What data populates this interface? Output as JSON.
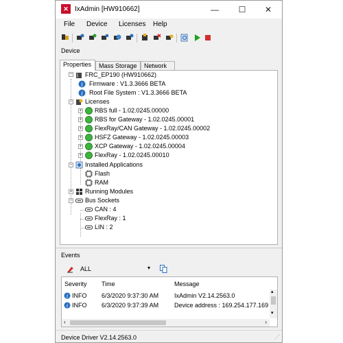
{
  "window": {
    "title": "IxAdmin [HW910662]",
    "minimize": "—",
    "maximize": "☐",
    "close": "✕"
  },
  "menu": [
    "File",
    "Device",
    "Licenses",
    "Help"
  ],
  "toolbar": {
    "icons": [
      "connect-icon",
      "device-icon",
      "device-refresh-icon",
      "device-add-icon",
      "globe-icon",
      "device-power-icon",
      "flash-icon",
      "delete-license-icon",
      "license-key-icon",
      "reboot-icon",
      "play-icon",
      "stop-icon"
    ],
    "colors": {
      "play": "#22a022",
      "stop": "#d03030"
    }
  },
  "device_label": "Device",
  "tabs": [
    "Properties",
    "Mass Storage",
    "Network"
  ],
  "active_tab": "Properties",
  "tree": {
    "root": "FRC_EP190 (HW910662)",
    "firmware": "Firmware : V1.3.3666 BETA",
    "rootfs": "Root File System : V1.3.3666 BETA",
    "licenses_label": "Licenses",
    "licenses": [
      "RBS full - 1.02.0245.00000",
      "RBS for Gateway - 1.02.0245.00001",
      "FlexRay/CAN Gateway - 1.02.0245.00002",
      "HSFZ Gateway - 1.02.0245.00003",
      "XCP Gateway - 1.02.0245.00004",
      "FlexRay - 1.02.0245.00010"
    ],
    "apps_label": "Installed Applications",
    "apps": [
      "Flash",
      "RAM"
    ],
    "modules_label": "Running Modules",
    "sockets_label": "Bus Sockets",
    "sockets": [
      "CAN : 4",
      "FlexRay : 1",
      "LIN : 2"
    ]
  },
  "events": {
    "label": "Events",
    "filter": "ALL",
    "columns": [
      "Severity",
      "Time",
      "Message"
    ],
    "rows": [
      {
        "severity": "INFO",
        "time": "6/3/2020 9:37:30 AM",
        "message": "IxAdmin V2.14.2563.0"
      },
      {
        "severity": "INFO",
        "time": "6/3/2020 9:37:39 AM",
        "message": "Device address : 169.254.177.169"
      }
    ]
  },
  "status": "Device Driver V2.14.2563.0"
}
